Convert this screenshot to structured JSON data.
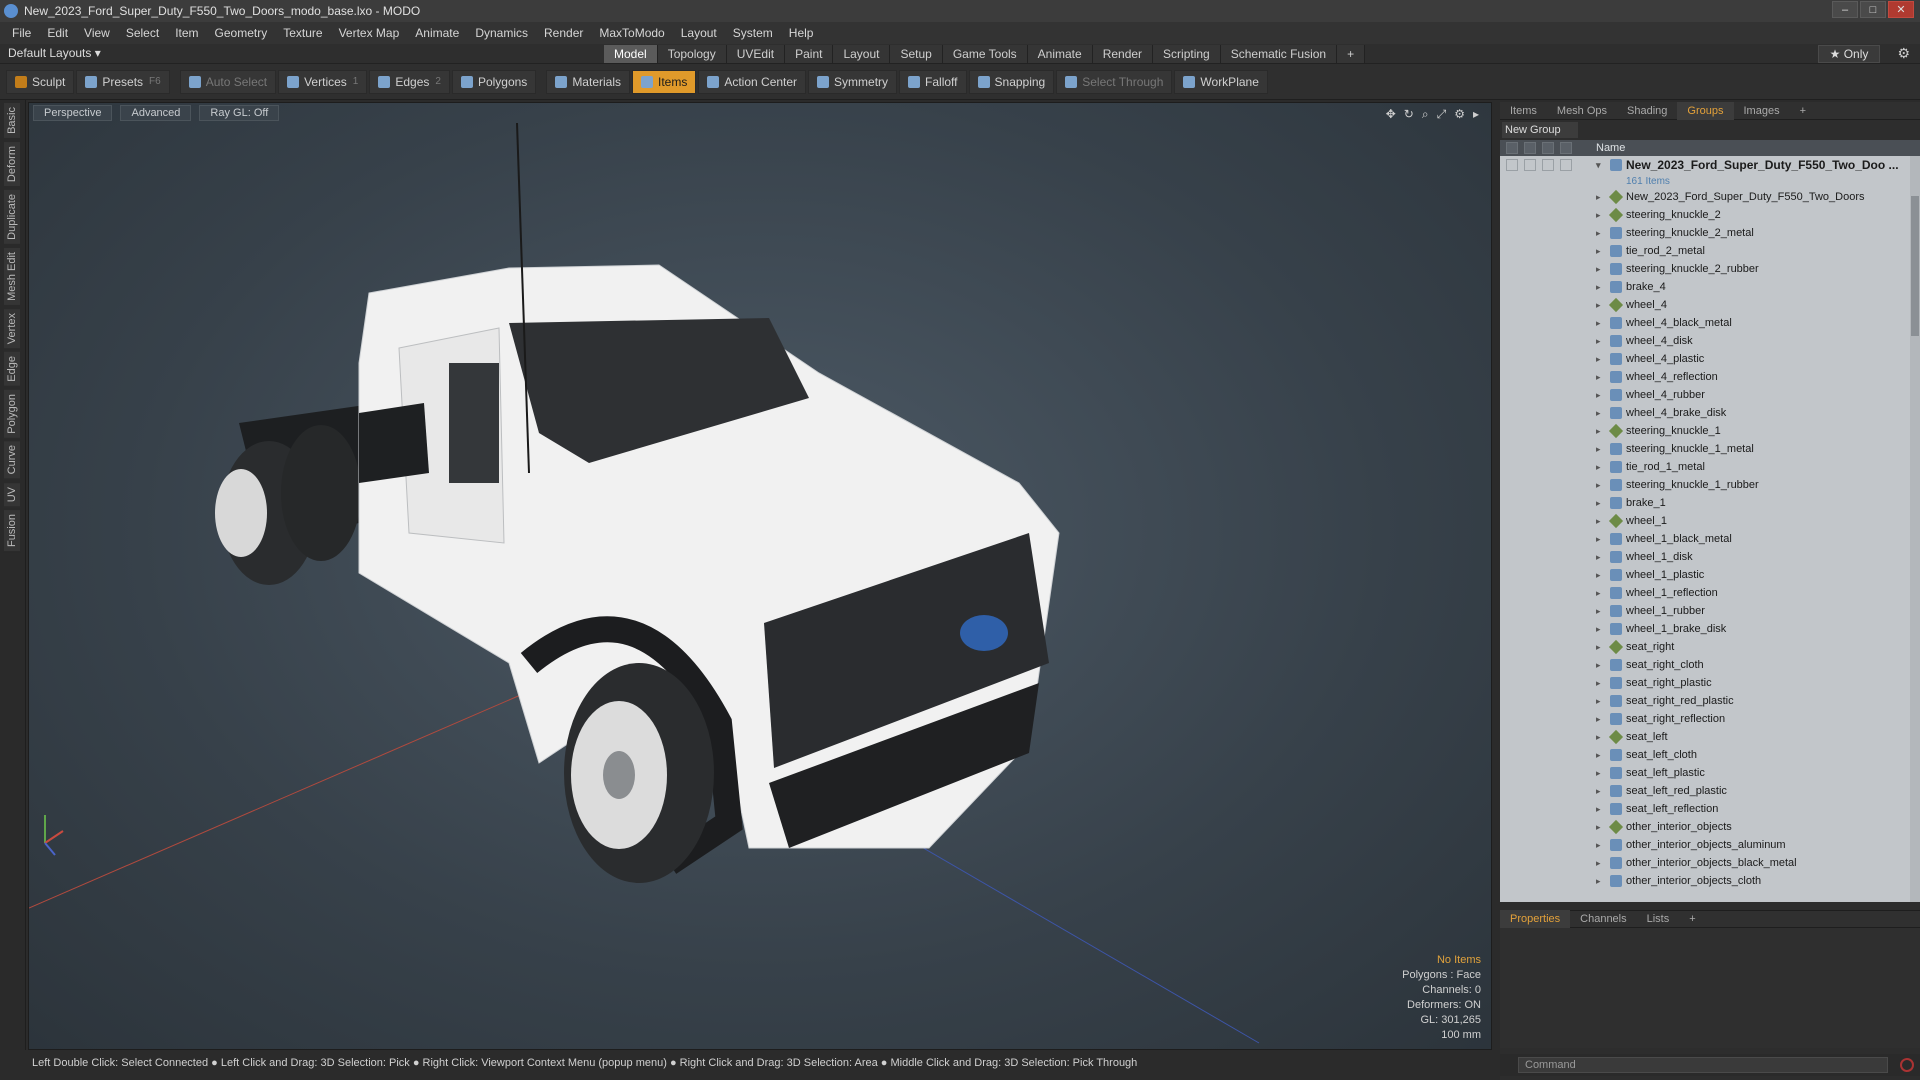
{
  "window": {
    "title": "New_2023_Ford_Super_Duty_F550_Two_Doors_modo_base.lxo - MODO"
  },
  "menu": [
    "File",
    "Edit",
    "View",
    "Select",
    "Item",
    "Geometry",
    "Texture",
    "Vertex Map",
    "Animate",
    "Dynamics",
    "Render",
    "MaxToModo",
    "Layout",
    "System",
    "Help"
  ],
  "layout": {
    "selector": "Default Layouts ▾",
    "tabs": [
      "Model",
      "Topology",
      "UVEdit",
      "Paint",
      "Layout",
      "Setup",
      "Game Tools",
      "Animate",
      "Render",
      "Scripting",
      "Schematic Fusion",
      "+"
    ],
    "active_tab": "Model",
    "only": "★ Only"
  },
  "toolbar": {
    "sculpt": "Sculpt",
    "presets": "Presets",
    "presets_key": "F6",
    "auto_select": "Auto Select",
    "vertices": "Vertices",
    "vertices_count": "1",
    "edges": "Edges",
    "edges_count": "2",
    "polygons": "Polygons",
    "materials": "Materials",
    "items": "Items",
    "action_center": "Action Center",
    "symmetry": "Symmetry",
    "falloff": "Falloff",
    "snapping": "Snapping",
    "select_through": "Select Through",
    "workplane": "WorkPlane"
  },
  "left_tabs": [
    "Basic",
    "Deform",
    "Duplicate",
    "Mesh Edit",
    "Vertex",
    "Edge",
    "Polygon",
    "Curve",
    "UV",
    "Fusion"
  ],
  "viewport": {
    "view": "Perspective",
    "shading": "Advanced",
    "raygl": "Ray GL: Off",
    "info": {
      "items": "No Items",
      "polygons": "Polygons : Face",
      "channels": "Channels: 0",
      "deformers": "Deformers: ON",
      "gl": "GL: 301,265",
      "scale": "100 mm"
    }
  },
  "status": "Left Double Click: Select Connected ● Left Click and Drag: 3D Selection: Pick ● Right Click: Viewport Context Menu (popup menu) ● Right Click and Drag: 3D Selection: Area ● Middle Click and Drag: 3D Selection: Pick Through",
  "panel": {
    "tabs": [
      "Items",
      "Mesh Ops",
      "Shading",
      "Groups",
      "Images",
      "+"
    ],
    "active_tab": "Groups",
    "new_group": "New Group",
    "name_header": "Name",
    "root": "New_2023_Ford_Super_Duty_F550_Two_Doo ...",
    "root_sub": "161 Items",
    "items": [
      "New_2023_Ford_Super_Duty_F550_Two_Doors",
      "steering_knuckle_2",
      "steering_knuckle_2_metal",
      "tie_rod_2_metal",
      "steering_knuckle_2_rubber",
      "brake_4",
      "wheel_4",
      "wheel_4_black_metal",
      "wheel_4_disk",
      "wheel_4_plastic",
      "wheel_4_reflection",
      "wheel_4_rubber",
      "wheel_4_brake_disk",
      "steering_knuckle_1",
      "steering_knuckle_1_metal",
      "tie_rod_1_metal",
      "steering_knuckle_1_rubber",
      "brake_1",
      "wheel_1",
      "wheel_1_black_metal",
      "wheel_1_disk",
      "wheel_1_plastic",
      "wheel_1_reflection",
      "wheel_1_rubber",
      "wheel_1_brake_disk",
      "seat_right",
      "seat_right_cloth",
      "seat_right_plastic",
      "seat_right_red_plastic",
      "seat_right_reflection",
      "seat_left",
      "seat_left_cloth",
      "seat_left_plastic",
      "seat_left_red_plastic",
      "seat_left_reflection",
      "other_interior_objects",
      "other_interior_objects_aluminum",
      "other_interior_objects_black_metal",
      "other_interior_objects_cloth"
    ],
    "locator_items": [
      "New_2023_Ford_Super_Duty_F550_Two_Doors",
      "steering_knuckle_2",
      "wheel_4",
      "steering_knuckle_1",
      "wheel_1",
      "seat_right",
      "seat_left",
      "other_interior_objects"
    ],
    "bottom_tabs": [
      "Properties",
      "Channels",
      "Lists",
      "+"
    ],
    "bottom_active": "Properties",
    "command_placeholder": "Command"
  },
  "colors": {
    "accent": "#e09a2a",
    "viewport_bg": "#3c4750",
    "list_bg": "#c2c6ca"
  }
}
